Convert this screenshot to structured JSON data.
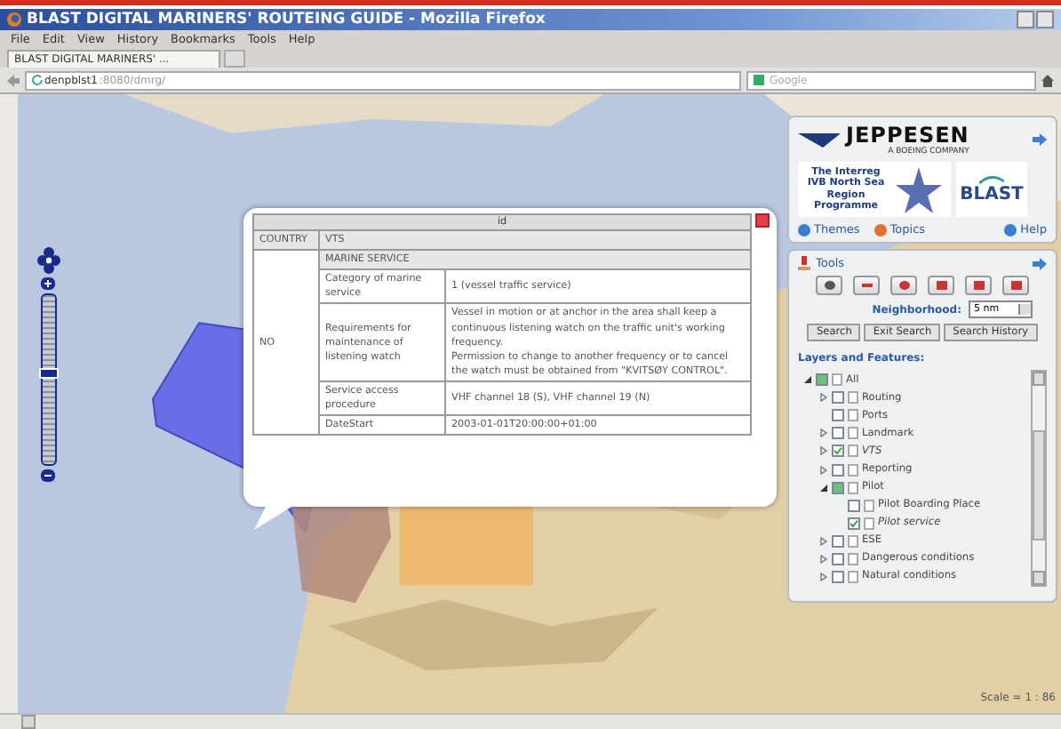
{
  "window": {
    "title": "BLAST DIGITAL MARINERS' ROUTEING GUIDE - Mozilla Firefox"
  },
  "menu": [
    "File",
    "Edit",
    "View",
    "History",
    "Bookmarks",
    "Tools",
    "Help"
  ],
  "tabs": [
    {
      "label": "BLAST DIGITAL MARINERS' ...",
      "selected": true
    }
  ],
  "address": {
    "host": "denpblst1",
    "path": ":8080/dmrg/"
  },
  "search": {
    "placeholder": "Google"
  },
  "zoom": {
    "level": 0.55
  },
  "popup": {
    "title": "id",
    "country_header": "COUNTRY",
    "type_header": "VTS",
    "country": "NO",
    "section": "MARINE SERVICE",
    "rows": [
      {
        "label": "Category of marine service",
        "paragraphs": [
          "1 (vessel traffic service)"
        ]
      },
      {
        "label": "Requirements for maintenance of listening watch",
        "paragraphs": [
          "Vessel in motion or at anchor in the area shall keep a continuous listening watch on the traffic unit's working frequency.",
          "Permission to change to another frequency or to cancel the watch must be obtained from \"KVITSØY CONTROL\"."
        ]
      },
      {
        "label": "Service access procedure",
        "paragraphs": [
          "VHF channel 18 (S), VHF channel 19 (N)"
        ]
      },
      {
        "label": "DateStart",
        "paragraphs": [
          "2003-01-01T20:00:00+01:00"
        ]
      }
    ]
  },
  "brand": {
    "name": "JEPPESEN",
    "tagline": "A BOEING COMPANY",
    "programme": "The Interreg IVB North Sea Region Programme",
    "project": "BLAST"
  },
  "links": [
    "Themes",
    "Topics",
    "Help"
  ],
  "tools": {
    "title": "Tools",
    "neighborhood_label": "Neighborhood:",
    "neighborhood": "5 nm",
    "buttons": [
      "Search",
      "Exit Search",
      "Search History"
    ]
  },
  "layers": {
    "title": "Layers and Features:",
    "tree": [
      {
        "label": "All",
        "checked": false,
        "partial": true,
        "expanded": true,
        "children": [
          {
            "label": "Routing",
            "checked": false,
            "partial": false,
            "expanded": false
          },
          {
            "label": "Ports",
            "checked": false,
            "partial": false
          },
          {
            "label": "Landmark",
            "checked": false,
            "partial": false,
            "expanded": false
          },
          {
            "label": "VTS",
            "checked": true,
            "partial": false,
            "expanded": false
          },
          {
            "label": "Reporting",
            "checked": false,
            "partial": false,
            "expanded": false
          },
          {
            "label": "Pilot",
            "checked": false,
            "partial": true,
            "expanded": true,
            "children": [
              {
                "label": "Pilot Boarding Place",
                "checked": false,
                "partial": false
              },
              {
                "label": "Pilot service",
                "checked": true,
                "partial": false
              }
            ]
          },
          {
            "label": "ESE",
            "checked": false,
            "partial": false,
            "expanded": false
          },
          {
            "label": "Dangerous conditions",
            "checked": false,
            "partial": false,
            "expanded": false
          },
          {
            "label": "Natural conditions",
            "checked": false,
            "partial": false,
            "expanded": false
          }
        ]
      }
    ]
  },
  "scale": "Scale = 1 : 86"
}
